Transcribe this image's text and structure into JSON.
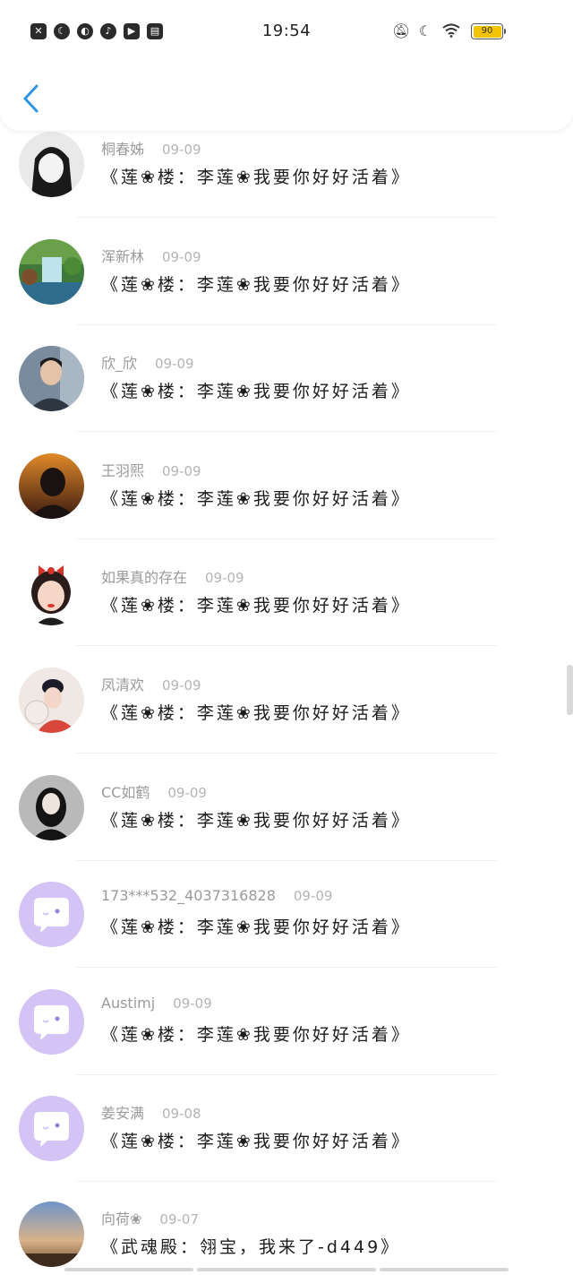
{
  "status_bar": {
    "time": "19:54",
    "battery": "90",
    "left_icons": [
      "sim-icon",
      "moon-icon",
      "app-icon",
      "music-icon",
      "video-icon",
      "book-icon"
    ],
    "right_icons": [
      "bell-off-icon",
      "moon-icon",
      "wifi-icon",
      "battery-icon"
    ]
  },
  "header": {
    "back_icon": "chevron-left-icon",
    "accent": "#2f95e3"
  },
  "comments": [
    {
      "name": "桐春姊",
      "date": "09-09",
      "text": "《莲❀楼：李莲❀我要你好好活着》",
      "avatar": "bw-portrait"
    },
    {
      "name": "浑新林",
      "date": "09-09",
      "text": "《莲❀楼：李莲❀我要你好好活着》",
      "avatar": "waterfall"
    },
    {
      "name": "欣_欣",
      "date": "09-09",
      "text": "《莲❀楼：李莲❀我要你好好活着》",
      "avatar": "man-suit"
    },
    {
      "name": "王羽熙",
      "date": "09-09",
      "text": "《莲❀楼：李莲❀我要你好好活着》",
      "avatar": "sunset-girl"
    },
    {
      "name": "如果真的存在",
      "date": "09-09",
      "text": "《莲❀楼：李莲❀我要你好好活着》",
      "avatar": "cartoon-girl"
    },
    {
      "name": "凤清欢",
      "date": "09-09",
      "text": "《莲❀楼：李莲❀我要你好好活着》",
      "avatar": "hanfu-girl"
    },
    {
      "name": "CC如鹤",
      "date": "09-09",
      "text": "《莲❀楼：李莲❀我要你好好活着》",
      "avatar": "dark-girl"
    },
    {
      "name": "173***532_4037316828",
      "date": "09-09",
      "text": "《莲❀楼：李莲❀我要你好好活着》",
      "avatar": "default"
    },
    {
      "name": "Austimj",
      "date": "09-09",
      "text": "《莲❀楼：李莲❀我要你好好活着》",
      "avatar": "default"
    },
    {
      "name": "姜安满",
      "date": "09-08",
      "text": "《莲❀楼：李莲❀我要你好好活着》",
      "avatar": "default"
    },
    {
      "name": "向荷❀",
      "date": "09-07",
      "text": "《武魂殿：翎宝，我来了-d449》",
      "avatar": "sky"
    }
  ]
}
